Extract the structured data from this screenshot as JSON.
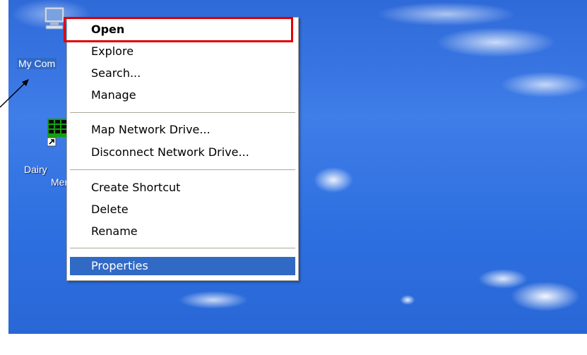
{
  "desktop": {
    "icons": [
      {
        "name": "my-computer",
        "label": "My Com",
        "selected": true,
        "icon": "computer-icon"
      },
      {
        "name": "dairy-menu",
        "label_line1": "Dairy",
        "label_line2": "Mer",
        "icon": "spreadsheet-shortcut-icon"
      }
    ]
  },
  "annotation": {
    "arrow_icon": "arrow-icon",
    "highlight_color": "#e00000"
  },
  "context_menu": {
    "items": [
      {
        "label": "Open",
        "bold": true
      },
      {
        "label": "Explore"
      },
      {
        "label": "Search..."
      },
      {
        "label": "Manage"
      },
      {
        "label": "Map Network Drive..."
      },
      {
        "label": "Disconnect Network Drive..."
      },
      {
        "label": "Create Shortcut"
      },
      {
        "label": "Delete"
      },
      {
        "label": "Rename"
      },
      {
        "label": "Properties",
        "highlighted": true
      }
    ]
  },
  "colors": {
    "menu_highlight": "#316ac5",
    "selection": "#3169c6"
  }
}
